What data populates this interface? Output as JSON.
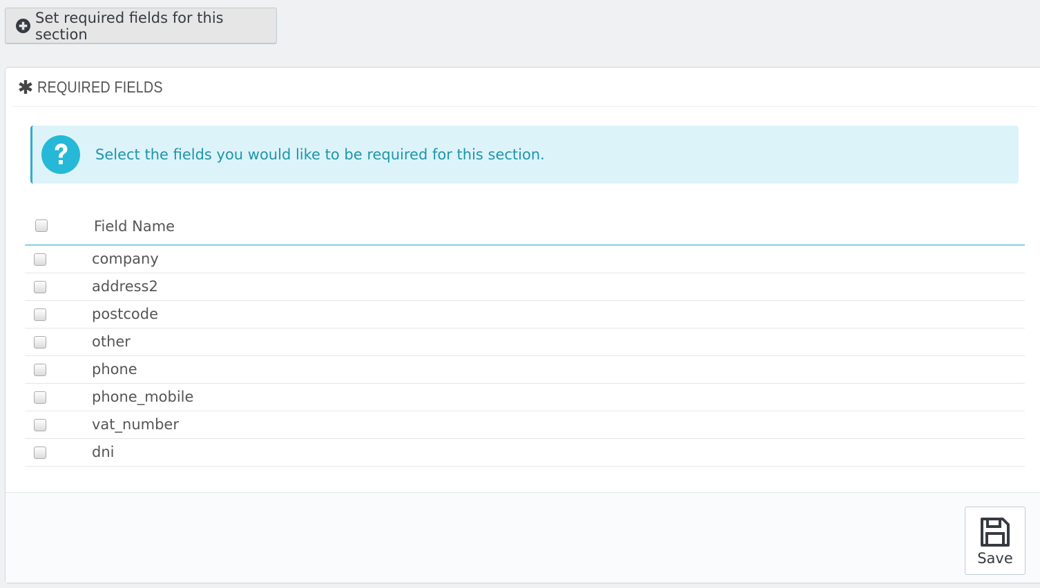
{
  "toolbar": {
    "set_required_label": "Set required fields for this section",
    "plus_icon": "plus-circle-icon"
  },
  "panel": {
    "heading_icon": "asterisk-icon",
    "heading": "REQUIRED FIELDS",
    "alert": {
      "icon": "question-circle-icon",
      "message": "Select the fields you would like to be required for this section."
    },
    "table": {
      "column_header": "Field Name",
      "rows": [
        {
          "name": "company",
          "checked": false
        },
        {
          "name": "address2",
          "checked": false
        },
        {
          "name": "postcode",
          "checked": false
        },
        {
          "name": "other",
          "checked": false
        },
        {
          "name": "phone",
          "checked": false
        },
        {
          "name": "phone_mobile",
          "checked": false
        },
        {
          "name": "vat_number",
          "checked": false
        },
        {
          "name": "dni",
          "checked": false
        }
      ]
    },
    "footer": {
      "save_label": "Save",
      "save_icon": "floppy-disk-icon"
    }
  },
  "colors": {
    "page_background": "#eff1f2",
    "alert_background": "#dcf4f9",
    "alert_text": "#1e94ab",
    "alert_icon": "#25b9d7",
    "header_rule": "#86d0e3"
  }
}
